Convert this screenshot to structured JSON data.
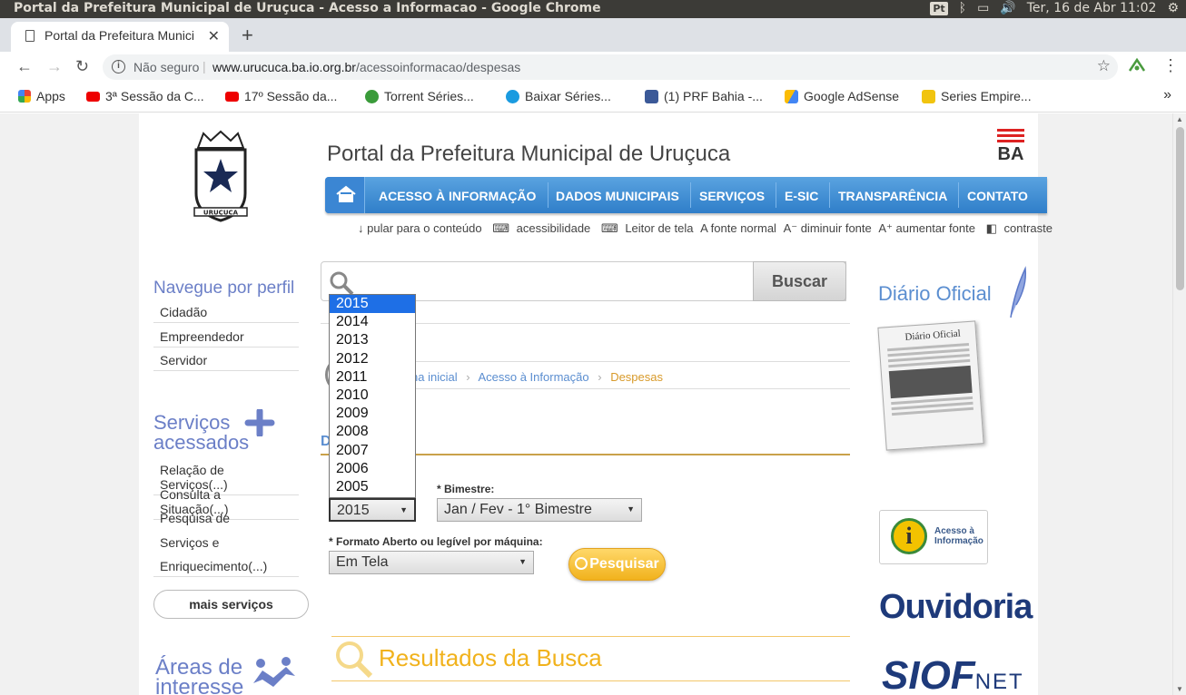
{
  "os": {
    "window_title": "Portal da Prefeitura Municipal de Uruçuca - Acesso a Informacao - Google Chrome",
    "lang": "Pt",
    "datetime": "Ter, 16 de Abr 11:02"
  },
  "browser": {
    "tab_title": "Portal da Prefeitura Munici",
    "not_secure": "Não seguro",
    "url_host": "www.urucuca.ba.io.org.br",
    "url_path": "/acessoinformacao/despesas",
    "bookmarks": [
      "Apps",
      "3ª Sessão da C...",
      "17º Sessão da...",
      "Torrent Séries...",
      "Baixar Séries...",
      "(1) PRF Bahia -...",
      "Google AdSense",
      "Series Empire..."
    ]
  },
  "site": {
    "title": "Portal da Prefeitura Municipal de Uruçuca",
    "state": "BA",
    "crest_text": "URUÇUCA",
    "nav": [
      "ACESSO À INFORMAÇÃO",
      "DADOS MUNICIPAIS",
      "SERVIÇOS",
      "E-SIC",
      "TRANSPARÊNCIA",
      "CONTATO"
    ],
    "accessibility": {
      "skip": "↓ pular para o conteúdo",
      "acess": "acessibilidade",
      "reader": "Leitor de tela",
      "normal": "A fonte normal",
      "smaller": "A⁻ diminuir fonte",
      "larger": "A⁺ aumentar fonte",
      "contrast": "contraste"
    }
  },
  "left": {
    "perfil_title": "Navegue por perfil",
    "perfil_items": [
      "Cidadão",
      "Empreendedor",
      "Servidor"
    ],
    "servicos_title_1": "Serviços",
    "servicos_title_2": "acessados",
    "servicos_items": [
      "Relação de Serviços(...)",
      "Consulta a Situação(...)",
      "Pesquisa de",
      "Serviços e",
      "Enriquecimento(...)"
    ],
    "mais": "mais serviços",
    "areas_title_1": "Áreas de",
    "areas_title_2": "interesse"
  },
  "main": {
    "search_button": "Buscar",
    "breadcrumb": [
      "na inicial",
      "Acesso à Informação",
      "Despesas"
    ],
    "section_initial": "D",
    "bimestre_label": "* Bimestre:",
    "ano_value": "2015",
    "bimestre_value": "Jan / Fev - 1° Bimestre",
    "formato_label": "* Formato Aberto ou legível por máquina:",
    "formato_value": "Em Tela",
    "pesquisar": "Pesquisar",
    "results_title": "Resultados da Busca",
    "year_options": [
      "2015",
      "2014",
      "2013",
      "2012",
      "2011",
      "2010",
      "2009",
      "2008",
      "2007",
      "2006",
      "2005"
    ]
  },
  "right": {
    "diario_title": "Diário Oficial",
    "newspaper_head": "Diário Oficial",
    "acesso_1": "Acesso à",
    "acesso_2": "Informação",
    "ouvidoria": "Ouvidoria",
    "siof": "SIOF",
    "siof_net": "NET"
  }
}
